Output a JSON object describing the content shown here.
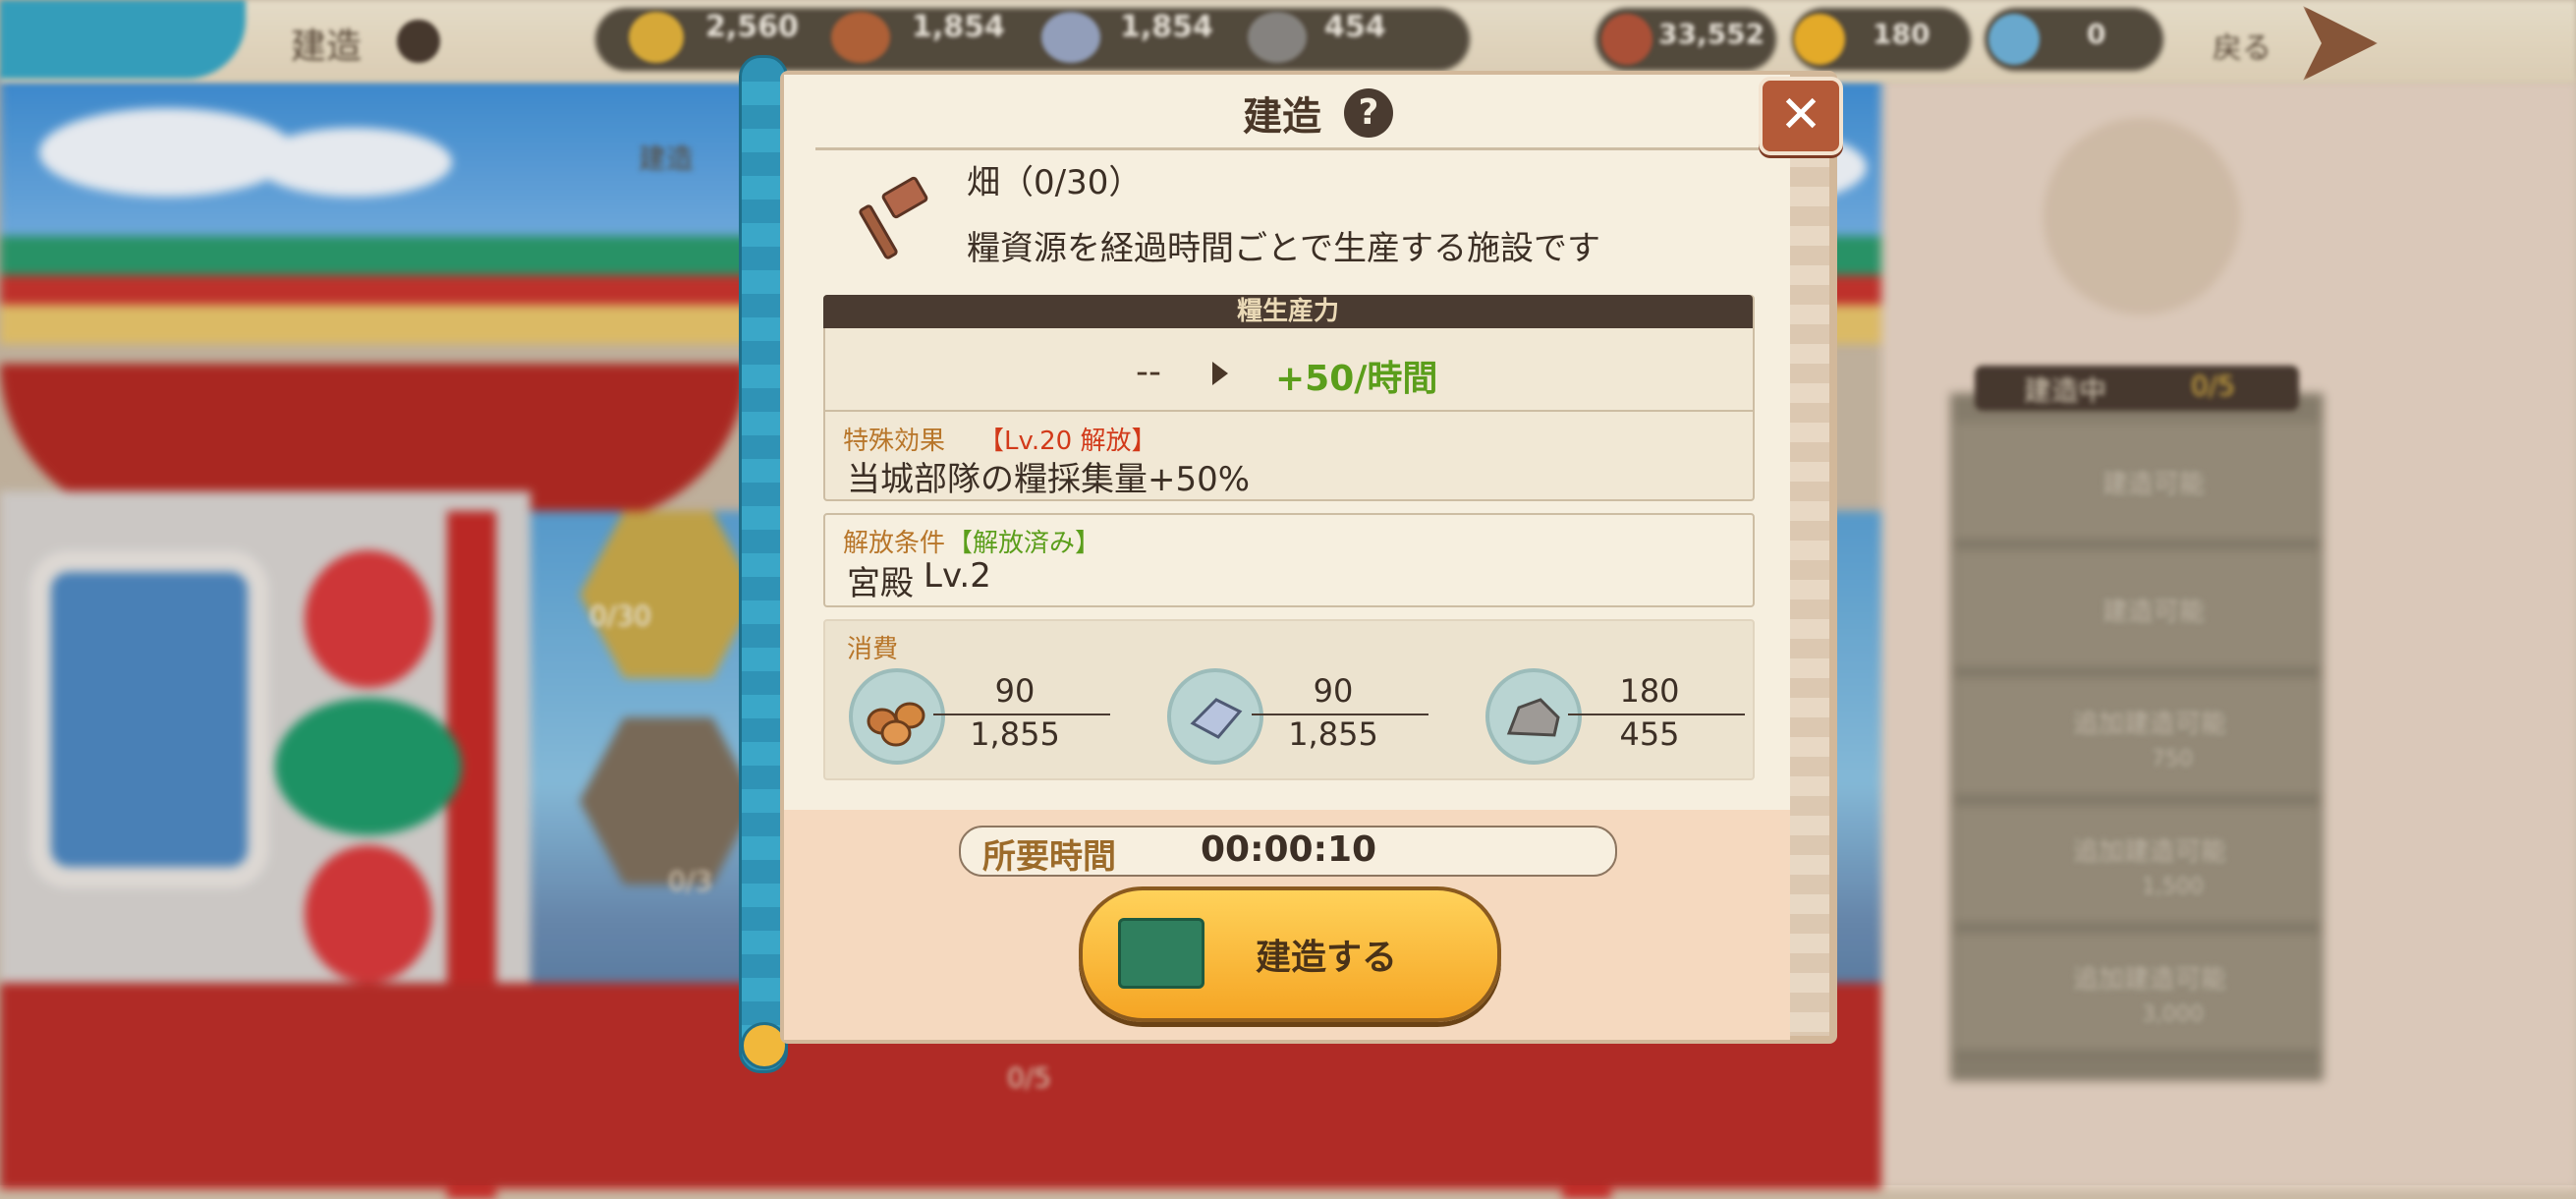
{
  "topbar": {
    "title": "建造",
    "resources": [
      {
        "name": "grain",
        "value": "2,560"
      },
      {
        "name": "wood",
        "value": "1,854"
      },
      {
        "name": "iron",
        "value": "1,854"
      },
      {
        "name": "stone",
        "value": "454"
      }
    ],
    "currencies": [
      {
        "name": "copper",
        "value": "33,552"
      },
      {
        "name": "gold",
        "value": "180"
      },
      {
        "name": "gem",
        "value": "0"
      }
    ],
    "back_label": "戻る"
  },
  "background": {
    "left_tab_label": "建造",
    "count_a": "0/30",
    "count_b": "0/3",
    "bottom_count": "0/5",
    "queue_header": "建造中",
    "queue_count": "0/5",
    "queue_rows": [
      {
        "label": "建造可能",
        "cost": ""
      },
      {
        "label": "建造可能",
        "cost": ""
      },
      {
        "label": "追加建造可能",
        "cost": "750"
      },
      {
        "label": "追加建造可能",
        "cost": "1,500"
      },
      {
        "label": "追加建造可能",
        "cost": "3,000"
      }
    ]
  },
  "modal": {
    "title": "建造",
    "building_name": "畑（0/30）",
    "building_desc": "糧資源を経過時間ごとで生産する施設です",
    "production": {
      "header": "糧生産力",
      "current": "--",
      "next": "+50/時間"
    },
    "special": {
      "label": "特殊効果",
      "lock": "【Lv.20 解放】",
      "text": "当城部隊の糧採集量+50%"
    },
    "unlock": {
      "label": "解放条件",
      "status": "【解放済み】",
      "building": "宮殿",
      "level": "Lv.2"
    },
    "cost": {
      "label": "消費",
      "items": [
        {
          "icon": "wood-icon",
          "need": "90",
          "have": "1,855"
        },
        {
          "icon": "iron-icon",
          "need": "90",
          "have": "1,855"
        },
        {
          "icon": "stone-icon",
          "need": "180",
          "have": "455"
        }
      ]
    },
    "time": {
      "label": "所要時間",
      "value": "00:00:10"
    },
    "build_button": "建造する"
  },
  "colors": {
    "accent_green": "#5b9e1b",
    "accent_red": "#d23a1a",
    "button_gold": "#f5a524",
    "close_brown": "#b45a38"
  }
}
